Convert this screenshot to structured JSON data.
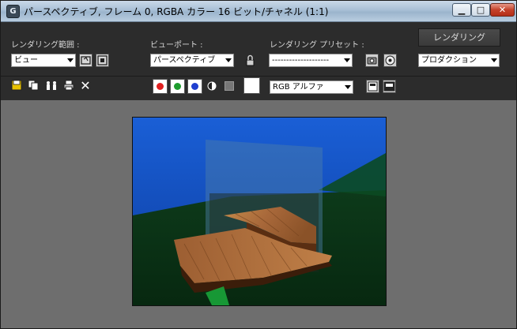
{
  "window": {
    "title": "パースペクティブ, フレーム 0, RGBA カラー 16 ビット/チャネル (1:1)",
    "app_icon_glyph": "G",
    "min_glyph": "▁",
    "max_glyph": "□",
    "close_glyph": "✕"
  },
  "toolbar": {
    "render_area_label": "レンダリング範囲 :",
    "render_area_value": "ビュー",
    "viewport_label": "ビューポート :",
    "viewport_value": "パースペクティブ",
    "preset_label": "レンダリング プリセット :",
    "preset_value": "--------------------",
    "render_button": "レンダリング",
    "render_mode_value": "プロダクション",
    "channel_value": "RGB アルファ"
  },
  "channels": {
    "red": "#e02020",
    "green": "#1f9d2f",
    "blue": "#1f3fd0"
  },
  "icons": [
    "edit-region-icon",
    "auto-region-icon",
    "lock-icon",
    "environment-icon",
    "render-setup-icon",
    "save-icon",
    "copy-icon",
    "clone-icon",
    "print-icon",
    "clear-icon",
    "mono-icon",
    "alpha-icon",
    "frame-window-icon",
    "split-icon"
  ]
}
